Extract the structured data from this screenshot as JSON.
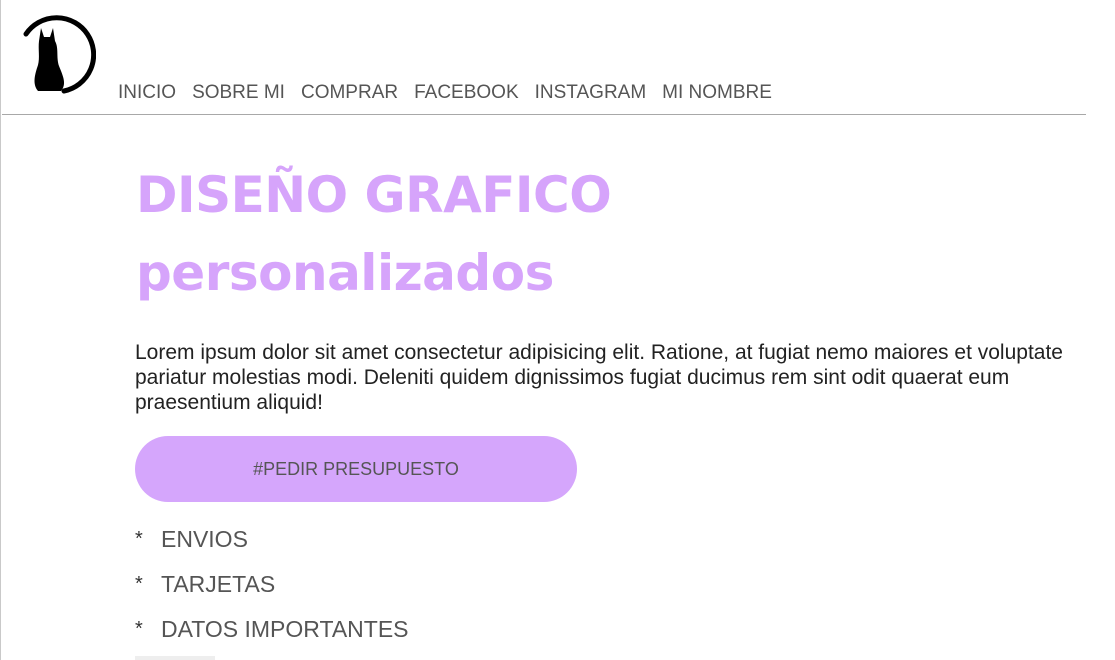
{
  "header": {
    "logo_icon": "cat-moon-logo-icon",
    "nav": [
      {
        "label": "INICIO"
      },
      {
        "label": "SOBRE MI"
      },
      {
        "label": "COMPRAR"
      },
      {
        "label": "FACEBOOK"
      },
      {
        "label": "INSTAGRAM"
      },
      {
        "label": "MI NOMBRE"
      }
    ]
  },
  "hero": {
    "title_line1": "DISEÑO GRAFICO",
    "title_line2": "personalizados",
    "text": "Lorem ipsum dolor sit amet consectetur adipisicing elit. Ratione, at fugiat nemo maiores et voluptate pariatur molestias modi. Deleniti quidem dignissimos fugiat ducimus rem sint odit quaerat eum praesentium aliquid!",
    "cta_label": "#PEDIR PRESUPUESTO"
  },
  "links": [
    {
      "bullet": "*",
      "label": "ENVIOS"
    },
    {
      "bullet": "*",
      "label": "TARJETAS"
    },
    {
      "bullet": "*",
      "label": "DATOS IMPORTANTES"
    }
  ],
  "colors": {
    "accent": "#d6a4fb",
    "nav_text": "#555555",
    "body_text": "#222222"
  }
}
